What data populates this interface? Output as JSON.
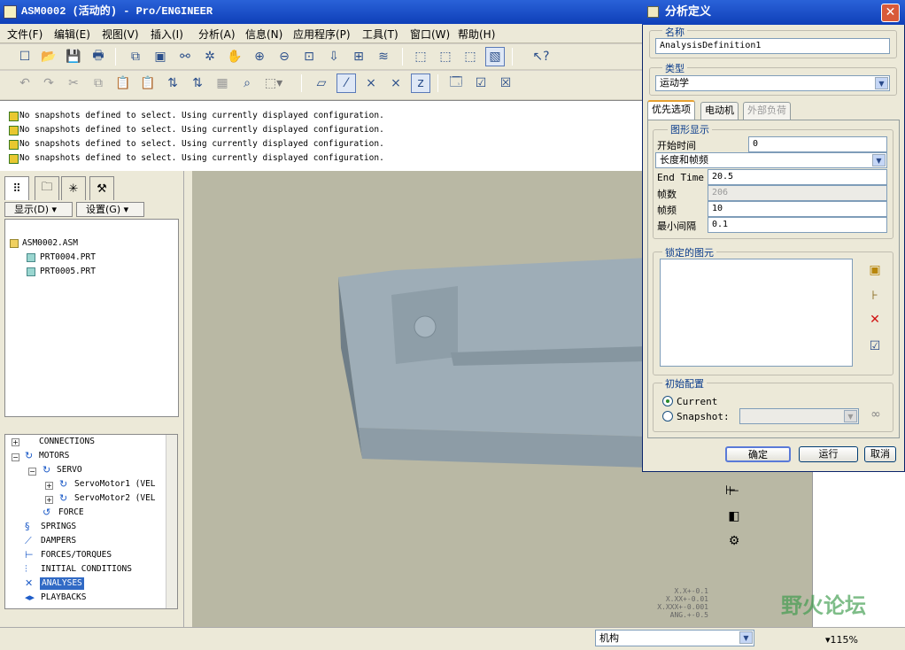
{
  "window": {
    "title": "ASM0002 (活动的) - Pro/ENGINEER"
  },
  "menubar": [
    "文件(F)",
    "编辑(E)",
    "视图(V)",
    "插入(I)",
    "分析(A)",
    "信息(N)",
    "应用程序(P)",
    "工具(T)",
    "窗口(W)",
    "帮助(H)"
  ],
  "messages": [
    "No snapshots defined to select. Using currently displayed configuration.",
    "No snapshots defined to select. Using currently displayed configuration.",
    "No snapshots defined to select. Using currently displayed configuration.",
    "No snapshots defined to select. Using currently displayed configuration."
  ],
  "left_panel": {
    "show_button": "显示(D)",
    "settings_button": "设置(G)",
    "model_tree": [
      "ASM0002.ASM",
      "PRT0004.PRT",
      "PRT0005.PRT"
    ],
    "mech_tree": {
      "connections": "CONNECTIONS",
      "motors": "MOTORS",
      "servo": "SERVO",
      "servo1": "ServoMotor1 (VEL",
      "servo2": "ServoMotor2 (VEL",
      "force": "FORCE",
      "springs": "SPRINGS",
      "dampers": "DAMPERS",
      "forces_torques": "FORCES/TORQUES",
      "initial_conditions": "INITIAL CONDITIONS",
      "analyses": "ANALYSES",
      "playbacks": "PLAYBACKS"
    }
  },
  "status": {
    "filter": "机构",
    "zoom": "115%",
    "tolerances": [
      "X.X+-0.1",
      "X.XX+-0.01",
      "X.XXX+-0.001",
      "ANG.+-0.5"
    ]
  },
  "watermark": "野火论坛",
  "dialog": {
    "title": "分析定义",
    "name_label": "名称",
    "name_value": "AnalysisDefinition1",
    "type_label": "类型",
    "type_value": "运动学",
    "tabs": [
      "优先选项",
      "电动机",
      "外部负荷"
    ],
    "graphic_display": "图形显示",
    "start_time_label": "开始时间",
    "start_time_value": "0",
    "mode_value": "长度和帧频",
    "end_time_label": "End Time",
    "end_time_value": "20.5",
    "frames_label": "帧数",
    "frames_value": "206",
    "frame_rate_label": "帧频",
    "frame_rate_value": "10",
    "min_interval_label": "最小间隔",
    "min_interval_value": "0.1",
    "locked_entities": "锁定的图元",
    "initial_config": "初始配置",
    "current_label": "Current",
    "snapshot_label": "Snapshot:",
    "ok": "确定",
    "run": "运行",
    "cancel": "取消"
  }
}
